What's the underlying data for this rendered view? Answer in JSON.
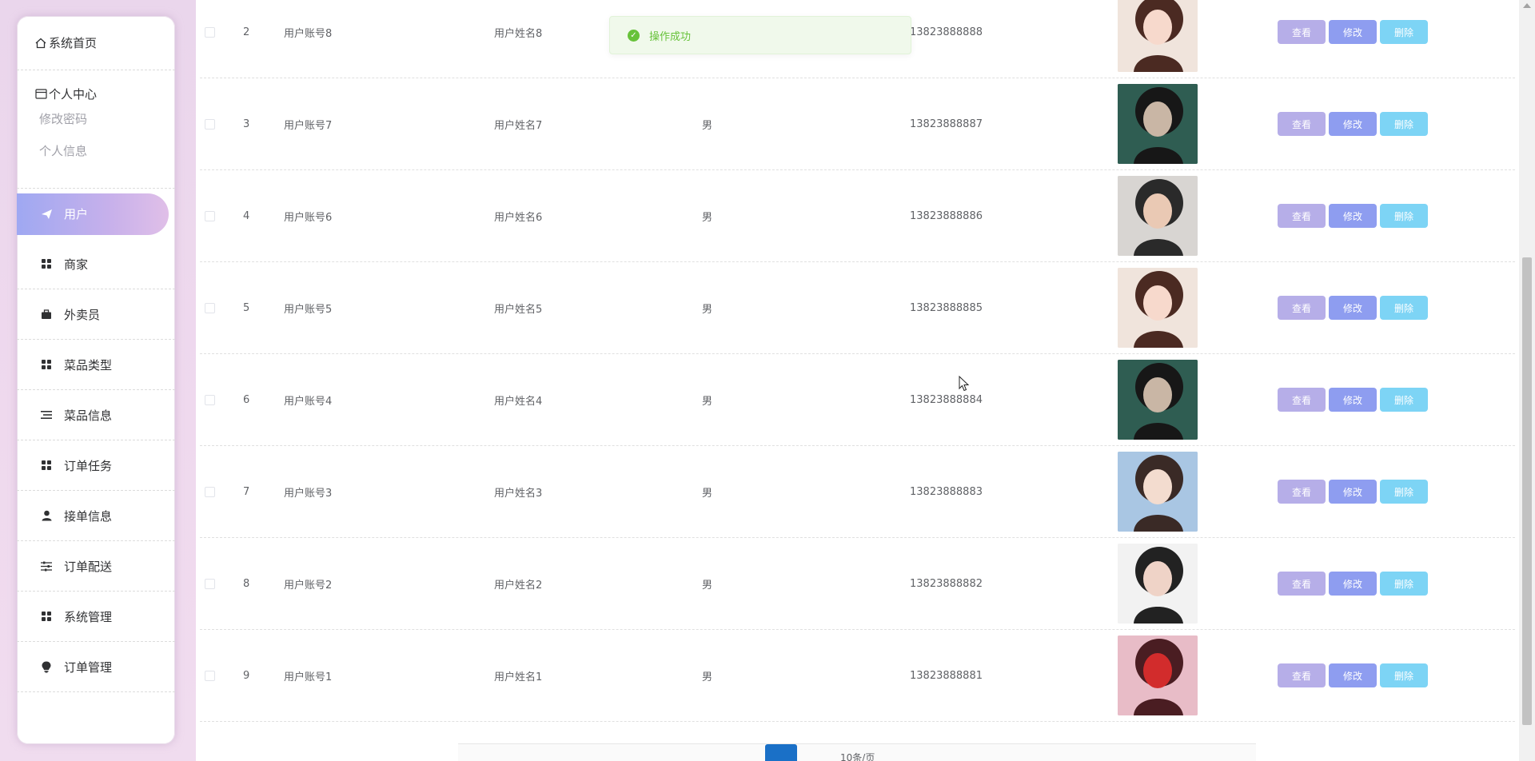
{
  "sidebar": {
    "home": "系统首页",
    "personal": {
      "title": "个人中心",
      "items": [
        "修改密码",
        "个人信息"
      ]
    },
    "items": [
      {
        "label": "用户",
        "icon": "paper-plane-icon",
        "active": true
      },
      {
        "label": "商家",
        "icon": "grid-icon"
      },
      {
        "label": "外卖员",
        "icon": "briefcase-icon"
      },
      {
        "label": "菜品类型",
        "icon": "grid-icon"
      },
      {
        "label": "菜品信息",
        "icon": "list-icon"
      },
      {
        "label": "订单任务",
        "icon": "grid-icon"
      },
      {
        "label": "接单信息",
        "icon": "user-icon"
      },
      {
        "label": "订单配送",
        "icon": "sliders-icon"
      },
      {
        "label": "系统管理",
        "icon": "grid-icon"
      },
      {
        "label": "订单管理",
        "icon": "lightbulb-icon"
      }
    ]
  },
  "toast": {
    "text": "操作成功"
  },
  "table": {
    "rows": [
      {
        "index": "2",
        "account": "用户账号8",
        "name": "用户姓名8",
        "sex": "",
        "phone": "13823888888"
      },
      {
        "index": "3",
        "account": "用户账号7",
        "name": "用户姓名7",
        "sex": "男",
        "phone": "13823888887"
      },
      {
        "index": "4",
        "account": "用户账号6",
        "name": "用户姓名6",
        "sex": "男",
        "phone": "13823888886"
      },
      {
        "index": "5",
        "account": "用户账号5",
        "name": "用户姓名5",
        "sex": "男",
        "phone": "13823888885"
      },
      {
        "index": "6",
        "account": "用户账号4",
        "name": "用户姓名4",
        "sex": "男",
        "phone": "13823888884"
      },
      {
        "index": "7",
        "account": "用户账号3",
        "name": "用户姓名3",
        "sex": "男",
        "phone": "13823888883"
      },
      {
        "index": "8",
        "account": "用户账号2",
        "name": "用户姓名2",
        "sex": "男",
        "phone": "13823888882"
      },
      {
        "index": "9",
        "account": "用户账号1",
        "name": "用户姓名1",
        "sex": "男",
        "phone": "13823888881"
      }
    ],
    "actions": {
      "view": "查看",
      "edit": "修改",
      "delete": "删除"
    }
  },
  "pagination": {
    "page_size": "10条/页"
  },
  "colors": {
    "view_button": "#b6aee8",
    "edit_button": "#8e9df0",
    "delete_button": "#7dd4f5",
    "active_page": "#1a70c7",
    "toast_text": "#67c23a"
  }
}
